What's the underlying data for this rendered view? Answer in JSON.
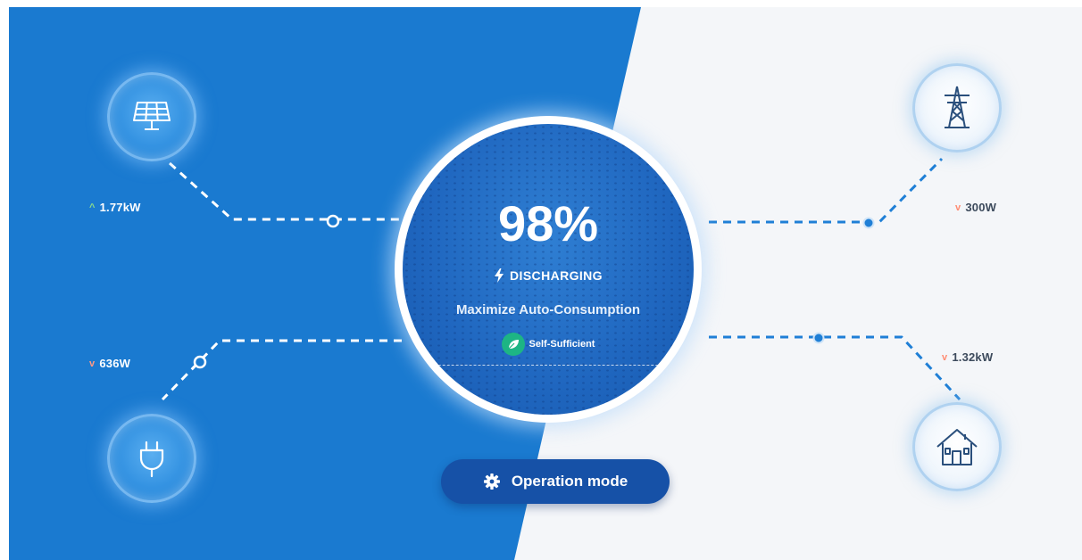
{
  "center": {
    "percentage": "98%",
    "status_label": "DISCHARGING",
    "mode_label": "Maximize Auto-Consumption",
    "badge_label": "Self-Sufficient",
    "battery_level": 0.98
  },
  "flows": {
    "solar": {
      "value": "1.77kW",
      "direction": "up",
      "arrow_color": "#8bdc8b"
    },
    "consumption": {
      "value": "636W",
      "direction": "down",
      "arrow_color": "#ff9a85"
    },
    "grid": {
      "value": "300W",
      "direction": "down",
      "arrow_color": "#ff8c73"
    },
    "home": {
      "value": "1.32kW",
      "direction": "down",
      "arrow_color": "#ff8c73"
    }
  },
  "buttons": {
    "operation_mode": "Operation mode"
  },
  "icons": {
    "solar": "solar-panel-icon",
    "plug": "plug-icon",
    "grid": "power-tower-icon",
    "home": "house-icon",
    "status": "lightning-icon",
    "badge": "leaf-icon",
    "button": "gear-icon"
  },
  "colors": {
    "primary_blue": "#1a7ad0",
    "light_bg": "#f4f6f9",
    "button_blue": "#1651a7",
    "badge_green": "#1db584"
  }
}
